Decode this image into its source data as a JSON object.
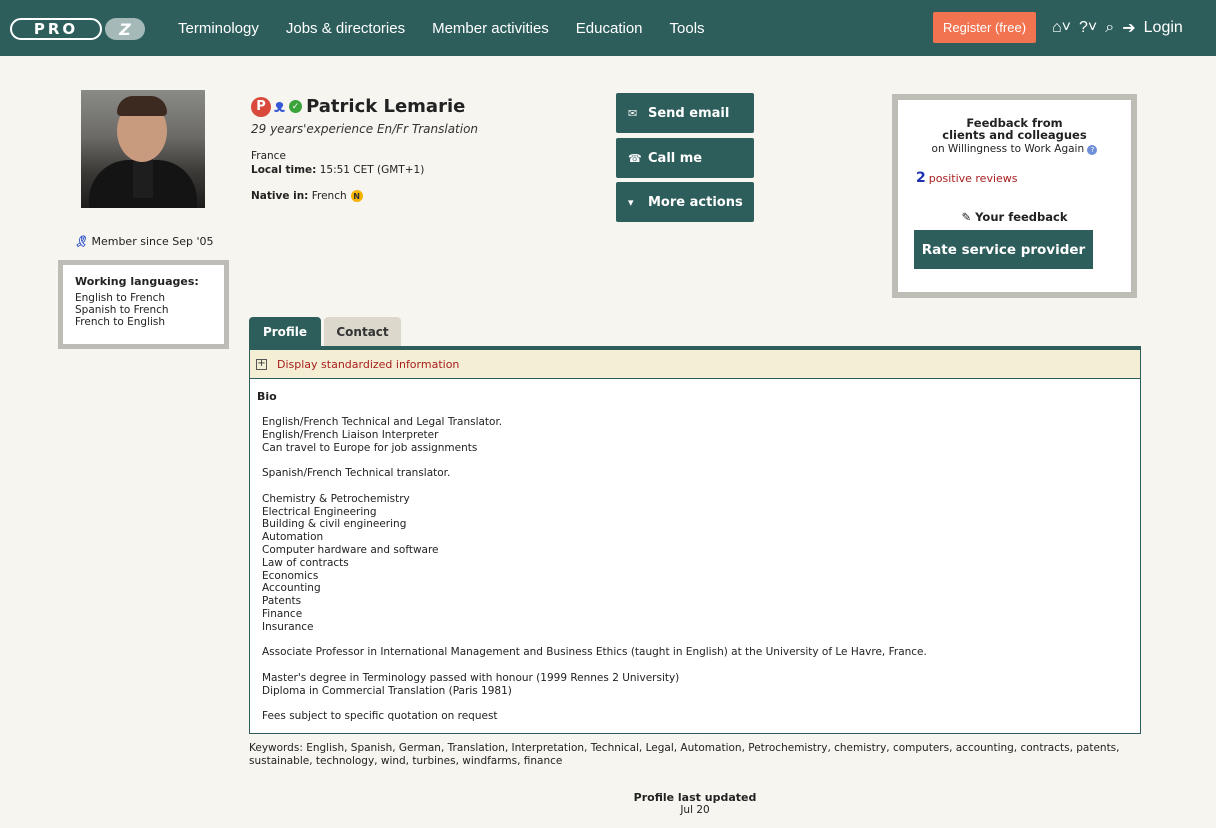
{
  "nav": {
    "logo_text": "PRO",
    "logo_z": "Z",
    "links": [
      "Terminology",
      "Jobs & directories",
      "Member activities",
      "Education",
      "Tools"
    ],
    "register": "Register (free)",
    "login": "Login"
  },
  "profile": {
    "name": "Patrick Lemarie",
    "tagline": "29 years'experience En/Fr Translation",
    "country": "France",
    "local_time_label": "Local time:",
    "local_time": "15:51 CET (GMT+1)",
    "native_label": "Native in:",
    "native": "French",
    "member_since": "Member since Sep '05"
  },
  "working_languages": {
    "title": "Working languages:",
    "items": [
      "English to French",
      "Spanish to French",
      "French to English"
    ]
  },
  "actions": {
    "send_email": "Send email",
    "call_me": "Call me",
    "more_actions": "More actions"
  },
  "feedback": {
    "title_line1": "Feedback from",
    "title_line2": "clients and colleagues",
    "subtitle": "on Willingness to Work Again",
    "count": "2",
    "reviews": "positive reviews",
    "your_feedback": "Your feedback",
    "rate_button": "Rate service provider"
  },
  "tabs": {
    "profile": "Profile",
    "contact": "Contact"
  },
  "standardized": "Display standardized information",
  "bio_heading": "Bio",
  "bio_lines": [
    "English/French Technical and Legal Translator.",
    "English/French Liaison Interpreter",
    "Can travel to Europe for job assignments",
    "",
    "Spanish/French Technical translator.",
    "",
    "Chemistry & Petrochemistry",
    "Electrical Engineering",
    "Building & civil engineering",
    "Automation",
    "Computer hardware and software",
    "Law of contracts",
    "Economics",
    "Accounting",
    "Patents",
    "Finance",
    "Insurance",
    "",
    "Associate Professor in International Management and Business Ethics (taught in English) at the University of Le Havre, France.",
    "",
    "Master's degree in Terminology passed with honour (1999 Rennes 2 University)",
    "Diploma in Commercial Translation (Paris 1981)",
    "",
    "Fees subject to specific quotation on request"
  ],
  "keywords": "Keywords: English, Spanish, German, Translation, Interpretation, Technical, Legal, Automation, Petrochemistry, chemistry, computers, accounting, contracts, patents, sustainable, technology, wind, turbines, windfarms, finance",
  "updated": {
    "label": "Profile last updated",
    "date": "Jul 20"
  }
}
